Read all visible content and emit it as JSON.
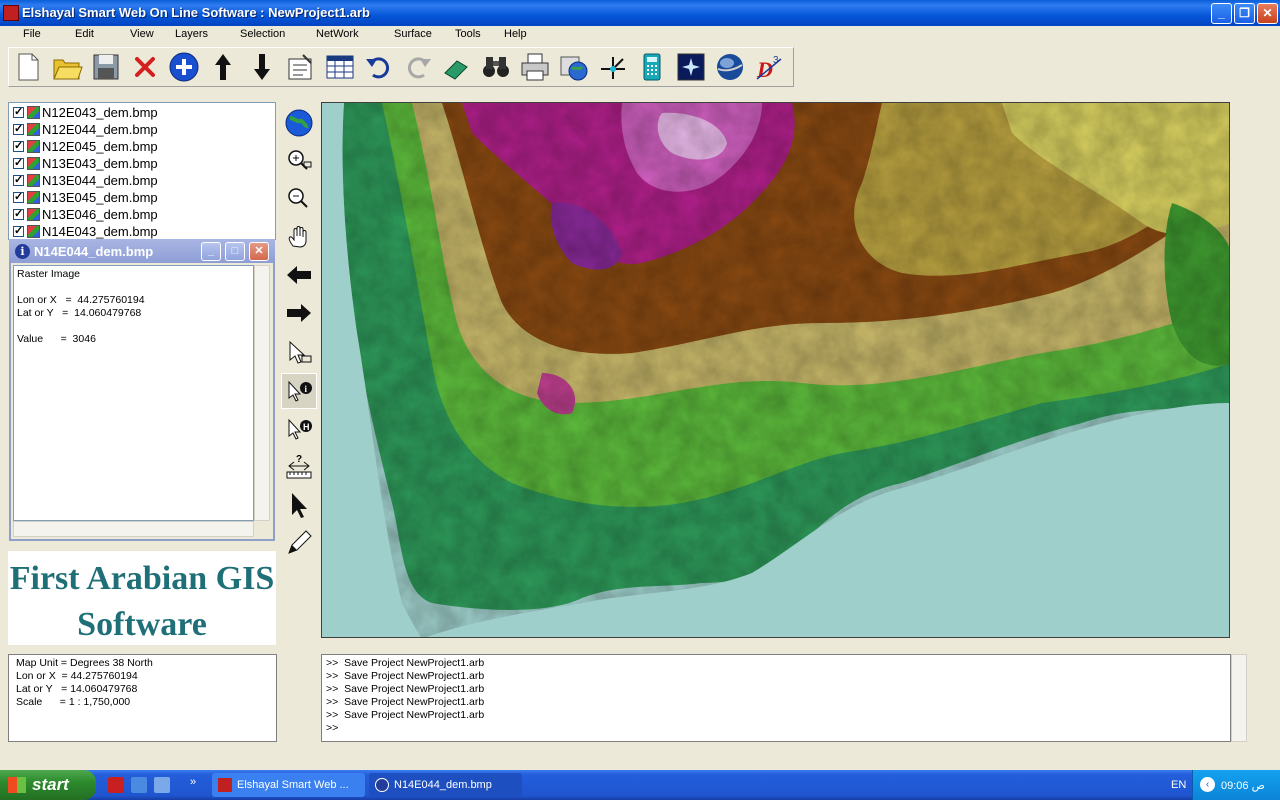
{
  "window": {
    "title": "Elshayal Smart Web On Line Software : NewProject1.arb",
    "controls": [
      "_",
      "❐",
      "✕"
    ]
  },
  "menu": [
    "File",
    "Edit",
    "View",
    "Layers",
    "Selection",
    "NetWork",
    "Surface",
    "Tools",
    "Help"
  ],
  "toolbar": {
    "icons": [
      "new-icon",
      "open-folder-icon",
      "save-icon",
      "delete-icon",
      "add-layer-icon",
      "move-up-icon",
      "move-down-icon",
      "properties-icon",
      "attribute-table-icon",
      "undo-icon",
      "redo-icon",
      "eraser-icon",
      "find-binoculars-icon",
      "print-icon",
      "map-globe-icon",
      "coordinate-icon",
      "calculator-icon",
      "raster-icon",
      "google-earth-icon",
      "3d-view-icon"
    ]
  },
  "layers": [
    {
      "name": "N12E043_dem.bmp",
      "checked": true
    },
    {
      "name": "N12E044_dem.bmp",
      "checked": true
    },
    {
      "name": "N12E045_dem.bmp",
      "checked": true
    },
    {
      "name": "N13E043_dem.bmp",
      "checked": true
    },
    {
      "name": "N13E044_dem.bmp",
      "checked": true
    },
    {
      "name": "N13E045_dem.bmp",
      "checked": true
    },
    {
      "name": "N13E046_dem.bmp",
      "checked": true
    },
    {
      "name": "N14E043_dem.bmp",
      "checked": true
    }
  ],
  "info_window": {
    "title": "N14E044_dem.bmp",
    "icon": "i",
    "lines": [
      "Raster Image",
      "",
      "Lon or X   =  44.275760194",
      "Lat or Y   =  14.060479768",
      "",
      "Value      =  3046"
    ]
  },
  "banner": {
    "line1": "First Arabian GIS",
    "line2": "Software"
  },
  "side_tools": [
    "full-extent-globe-icon",
    "zoom-in-icon",
    "zoom-out-icon",
    "pan-hand-icon",
    "back-arrow-icon",
    "forward-arrow-icon",
    "select-pointer-icon",
    "identify-info-icon",
    "hyperlink-icon",
    "measure-icon",
    "arrow-pointer-icon",
    "pencil-icon"
  ],
  "status": [
    "Map Unit = Degrees 38 North",
    "Lon or X  = 44.275760194",
    "Lat or Y   = 14.060479768",
    "Scale      = 1 : 1,750,000"
  ],
  "console": [
    ">>  Save Project NewProject1.arb",
    ">>  Save Project NewProject1.arb",
    ">>  Save Project NewProject1.arb",
    ">>  Save Project NewProject1.arb",
    ">>  Save Project NewProject1.arb",
    ">>"
  ],
  "taskbar": {
    "start": "start",
    "tasks": [
      "Elshayal Smart Web ...",
      "N14E044_dem.bmp"
    ],
    "lang": "EN",
    "clock": "09:06 ص"
  },
  "colors": {
    "titlebar": "#0556d8",
    "sea": "#9fcfcb",
    "banner_text": "#1f6f78"
  }
}
